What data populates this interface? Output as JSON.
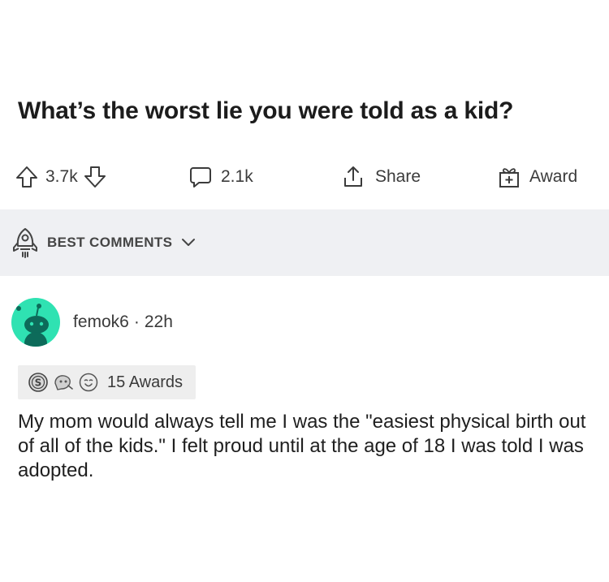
{
  "post": {
    "title": "What’s the worst lie you were told as a kid?"
  },
  "actions": {
    "upvote_icon": "upvote-arrow-icon",
    "vote_count": "3.7k",
    "downvote_icon": "downvote-arrow-icon",
    "comment_icon": "comment-bubble-icon",
    "comment_count": "2.1k",
    "share_icon": "share-upload-icon",
    "share_label": "Share",
    "award_icon": "gift-box-icon",
    "award_label": "Award"
  },
  "sort": {
    "icon": "rocket-icon",
    "label": "BEST COMMENTS",
    "chevron_icon": "chevron-down-icon"
  },
  "comment": {
    "avatar_color": "#2fe2b2",
    "username": "femok6",
    "separator": "·",
    "age": "22h",
    "awards_label": "15 Awards",
    "award_icons": [
      "silver-coin-icon",
      "helpful-award-icon",
      "wholesome-award-icon"
    ],
    "body": "My mom would always tell me I was the \"easiest physical birth out of all of the kids.\" I felt proud until at the age of 18 I was told I was adopted."
  }
}
